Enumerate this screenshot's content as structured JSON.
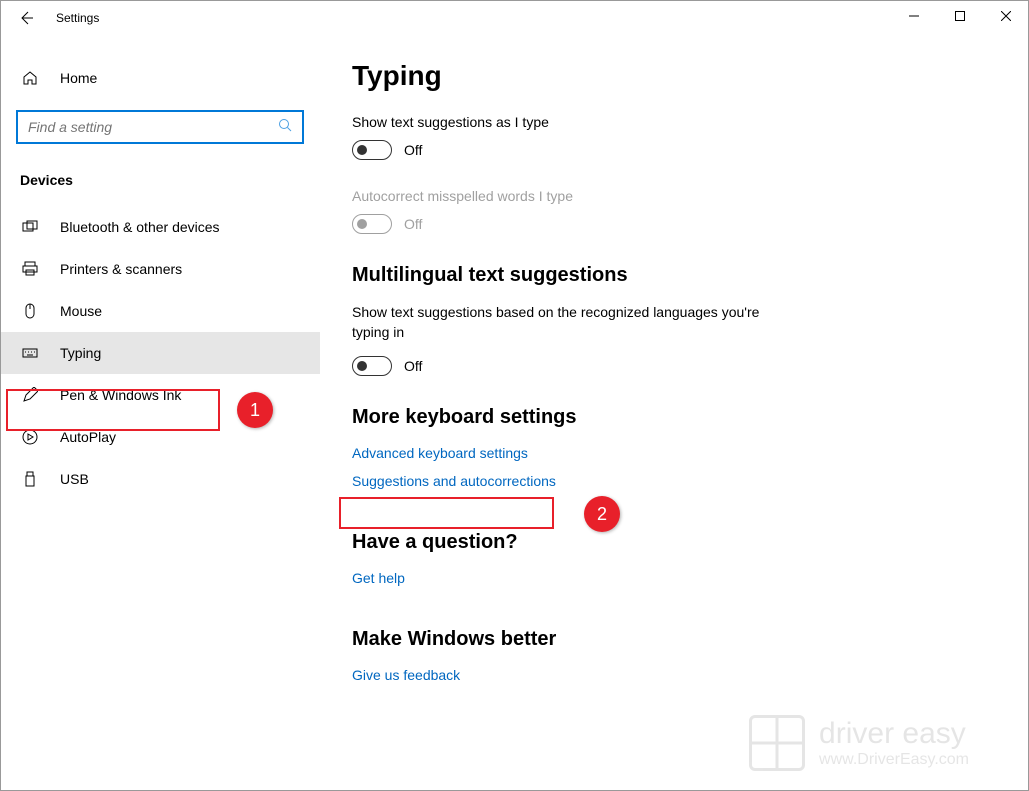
{
  "window": {
    "title": "Settings"
  },
  "sidebar": {
    "home_label": "Home",
    "search_placeholder": "Find a setting",
    "section_label": "Devices",
    "items": [
      {
        "label": "Bluetooth & other devices",
        "icon": "bluetooth-devices-icon"
      },
      {
        "label": "Printers & scanners",
        "icon": "printers-icon"
      },
      {
        "label": "Mouse",
        "icon": "mouse-icon"
      },
      {
        "label": "Typing",
        "icon": "keyboard-icon",
        "selected": true
      },
      {
        "label": "Pen & Windows Ink",
        "icon": "pen-icon"
      },
      {
        "label": "AutoPlay",
        "icon": "autoplay-icon"
      },
      {
        "label": "USB",
        "icon": "usb-icon"
      }
    ]
  },
  "content": {
    "page_title": "Typing",
    "settings": [
      {
        "label": "Show text suggestions as I type",
        "state": "Off",
        "disabled": false
      },
      {
        "label": "Autocorrect misspelled words I type",
        "state": "Off",
        "disabled": true
      }
    ],
    "multilingual_heading": "Multilingual text suggestions",
    "multilingual_desc": "Show text suggestions based on the recognized languages you're typing in",
    "multilingual_state": "Off",
    "more_heading": "More keyboard settings",
    "link_advanced": "Advanced keyboard settings",
    "link_suggestions": "Suggestions and autocorrections",
    "question_heading": "Have a question?",
    "link_help": "Get help",
    "better_heading": "Make Windows better",
    "link_feedback": "Give us feedback"
  },
  "annotations": {
    "badge1": "1",
    "badge2": "2"
  },
  "watermark": {
    "brand": "driver easy",
    "url": "www.DriverEasy.com"
  }
}
